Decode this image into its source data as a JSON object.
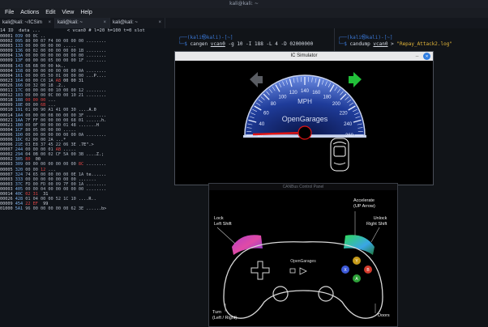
{
  "window": {
    "title": "kali@kali: ~"
  },
  "menu": [
    "File",
    "Actions",
    "Edit",
    "View",
    "Help"
  ],
  "tabs": [
    {
      "label": "kali@kali: ~/ICSim",
      "close": "×"
    },
    {
      "label": "kali@kali: ~",
      "close": "×"
    },
    {
      "label": "kali@kali: ~",
      "close": "×"
    }
  ],
  "dump": {
    "header": "14 ID  data ...          < vcan0 # l=20 h=100 t=0 slot",
    "rows": [
      [
        "00001",
        "039",
        "00 0C",
        "",
        ".."
      ],
      [
        "00002",
        "095",
        "80 00 07 F4 00 00 00 00",
        "",
        "........"
      ],
      [
        "00003",
        "133",
        "00 00 00 00 00",
        "",
        "....."
      ],
      [
        "00009",
        "136",
        "00 02 00 00 00 00 00 1B",
        "",
        "........"
      ],
      [
        "00004",
        "13A",
        "00 00 00 00 00 00 00 00",
        "",
        "........"
      ],
      [
        "00009",
        "13F",
        "00 00 00 05 00 00 00 1F",
        "",
        "........"
      ],
      [
        "00008",
        "143",
        "6B 6B 00 00",
        "",
        "kk.."
      ],
      [
        "00004",
        "158",
        "00 00 00 00 00 00 00 0A",
        "",
        "........"
      ],
      [
        "00004",
        "161",
        "00 00 05 50 01 00 00 00",
        "",
        "...P...."
      ],
      [
        "00023",
        "164",
        "00 00 C0 1A ",
        "A8",
        "00 00 31",
        "...1"
      ],
      [
        "00026",
        "166",
        "D0 32 00 18",
        "",
        ".2.."
      ],
      [
        "00011",
        "17C",
        "00 00 00 00 10 00 00 12",
        "",
        "........"
      ],
      [
        "00012",
        "183",
        "00 00 00 0C 00 00 10 21",
        "",
        "........"
      ],
      [
        "00018",
        "188",
        "",
        "00 00 00",
        "..."
      ],
      [
        "00009",
        "18E",
        "00 00 ",
        "6B",
        "..."
      ],
      [
        "00010",
        "191",
        "01 00 90 A1 41 00 30",
        "",
        "....A.0"
      ],
      [
        "00014",
        "1A4",
        "00 00 00 08 00 00 00 3F",
        "",
        "........"
      ],
      [
        "00021",
        "1AA",
        "7F FF 00 00 00 00 68 01",
        "",
        "......h."
      ],
      [
        "00021",
        "1B0",
        "00 0F 00 00 00 01 48",
        "",
        ".......H"
      ],
      [
        "00004",
        "1CF",
        "80 05 00 00 00",
        "",
        "....."
      ],
      [
        "00006",
        "1D0",
        "00 00 00 00 00 00 00 0A",
        "",
        "........"
      ],
      [
        "00006",
        "1DC",
        "02 00 00 2A",
        "",
        "...*"
      ],
      [
        "00006",
        "21E",
        "03 E8 37 45 22 06 3E",
        "",
        ".7E\".>"
      ],
      [
        "00007",
        "244",
        "00 00 00 01 ",
        "AB",
        "....."
      ],
      [
        "00002",
        "294",
        "04 0B 00 02 CF 5A 00 3B",
        "",
        "....Z.;"
      ],
      [
        "00002",
        "305",
        "",
        "80 ",
        "00"
      ],
      [
        "00003",
        "309",
        "00 00 00 00 00 00 00 ",
        "8C",
        "........"
      ],
      [
        "00005",
        "320",
        "00 00 ",
        "12",
        "..."
      ],
      [
        "00007",
        "324",
        "74 65 00 00 00 00 0E 1A",
        "",
        "te......"
      ],
      [
        "00003",
        "333",
        "00 00 00 00 00 00 00",
        "",
        "......."
      ],
      [
        "00003",
        "37C",
        "FD 00 FD 00 09 7F 00 1A",
        "",
        "........"
      ],
      [
        "00003",
        "405",
        "00 00 04 00 00 00 00 00",
        "",
        "........"
      ],
      [
        "00014",
        "40C",
        "",
        "02 31 ",
        "31",
        "..11"
      ],
      [
        "00026",
        "428",
        "01 04 00 00 52 1C 10",
        "",
        "....R.."
      ],
      [
        "00009",
        "454",
        "",
        "22 EF ",
        "99",
        "..."
      ],
      [
        "01000",
        "5A1",
        "96 00 00 00 00 00 62 3E",
        "",
        "......b>"
      ]
    ]
  },
  "terminals": {
    "mid": {
      "user": "kali",
      "host": "kali",
      "cwd": "~",
      "cmd": "cangen",
      "iface": "vcan0",
      "args": "-g 10 -I 188 -L 4 -D 02000000"
    },
    "right": {
      "user": "kali",
      "host": "kali",
      "cwd": "~",
      "cmd": "candump",
      "iface": "vcan0",
      "redir": ">",
      "file": "\"Repay_Attack2.log\""
    }
  },
  "ic_sim": {
    "title": "IC Simulator",
    "close_glyph": "✕",
    "min_glyph": "—",
    "speedo_unit": "MPH",
    "brand": "OpenGarages",
    "speed_ticks": [
      "20",
      "40",
      "60",
      "80",
      "100",
      "120",
      "140",
      "160",
      "180",
      "200",
      "220",
      "240",
      "260"
    ],
    "left_arrow_color": "#5a5d63",
    "right_arrow_color": "#22c03a",
    "needle_value": 0
  },
  "controller": {
    "title": "CANBus Control Panel",
    "labels": {
      "accelerate": "Accelerate\n(UP Arrow)",
      "lock": "Lock\nLeft Shift",
      "unlock": "Unlock\nRight Shift",
      "turn": "Turn\n(Left / Right)",
      "doors": "Doors"
    },
    "brand": "OpenGarages"
  }
}
